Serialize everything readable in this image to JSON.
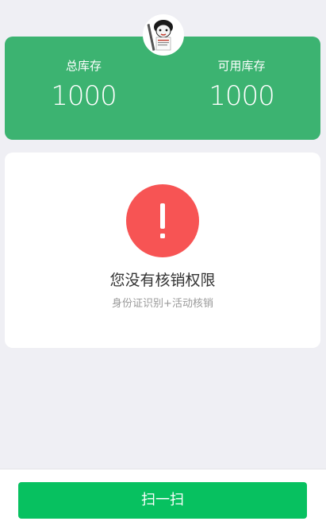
{
  "stock": {
    "total_label": "总库存",
    "total_value": "1000",
    "available_label": "可用库存",
    "available_value": "1000"
  },
  "notice": {
    "icon": "exclamation-icon",
    "title": "您没有核销权限",
    "subtitle": "身份证识别+活动核销"
  },
  "footer": {
    "scan_button_label": "扫一扫"
  },
  "colors": {
    "card_green": "#3cb371",
    "button_green": "#07c160",
    "warning_red": "#f75454",
    "background": "#efeff4"
  }
}
